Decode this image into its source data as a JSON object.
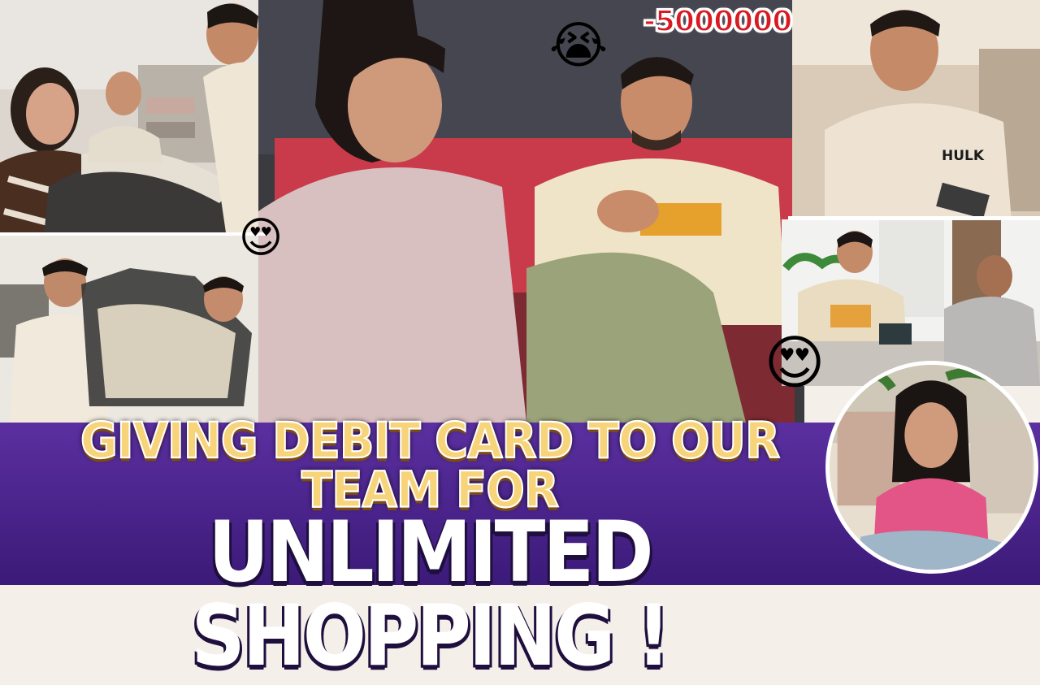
{
  "thumbnail": {
    "amount_badge": "-5000000",
    "headline": {
      "line1": "GIVING DEBIT CARD TO OUR TEAM FOR",
      "line2": "UNLIMITED SHOPPING !"
    },
    "tshirt_print": "HULK",
    "emojis": {
      "crying": "😭",
      "heart_eyes": "😍"
    },
    "colors": {
      "banner": "#4a2590",
      "headline_yellow": "#f7d47a",
      "amount_red": "#d81a22"
    }
  }
}
